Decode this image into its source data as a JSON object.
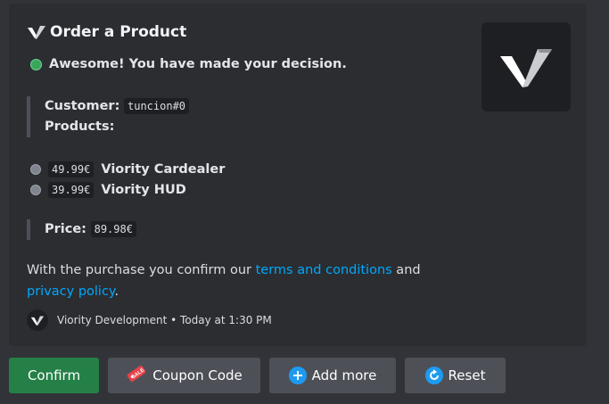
{
  "embed": {
    "title": "Order a Product",
    "status": "Awesome! You have made your decision.",
    "customer_label": "Customer:",
    "customer_value": "tuncion#0",
    "products_label": "Products:",
    "products": [
      {
        "price": "49.99€",
        "name": "Viority Cardealer"
      },
      {
        "price": "39.99€",
        "name": "Viority HUD"
      }
    ],
    "price_label": "Price:",
    "price_value": "89.98€",
    "confirm_text_pre": "With the purchase you confirm our ",
    "terms_link": "terms and conditions",
    "confirm_text_mid": " and",
    "privacy_link": "privacy policy",
    "confirm_text_post": ".",
    "footer_author": "Viority Development",
    "footer_sep": "•",
    "footer_time": "Today at 1:30 PM"
  },
  "buttons": {
    "confirm": "Confirm",
    "coupon": "Coupon Code",
    "add_more": "Add more",
    "reset": "Reset"
  },
  "icons": {
    "title_logo": "viority-logo-icon",
    "status_dot": "green-circle-icon",
    "product_dot": "grey-circle-icon",
    "coupon": "ticket-icon",
    "add_more": "plus-circle-icon",
    "reset": "refresh-icon"
  },
  "colors": {
    "background": "#313338",
    "embed_background": "#2b2d31",
    "link": "#00a8fc",
    "confirm_button": "#248046",
    "secondary_button": "#4e5058",
    "status_green": "#3ba55c"
  }
}
